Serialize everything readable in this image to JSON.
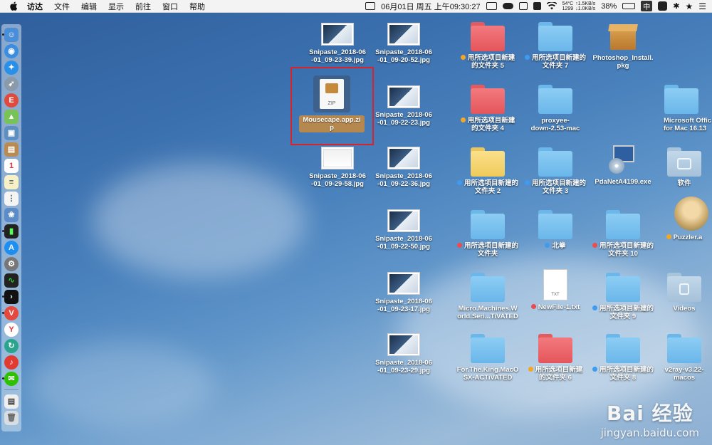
{
  "menubar": {
    "app_name": "访达",
    "menus": [
      "文件",
      "编辑",
      "显示",
      "前往",
      "窗口",
      "帮助"
    ],
    "temp": "54°C",
    "fan": "1299",
    "net_up": "↑1.5KB/s",
    "net_down": "↓1.0KB/s",
    "datetime": "06月01日 周五 上午09:30:27",
    "battery": "38%",
    "input_method": "中"
  },
  "desktop": {
    "items": [
      {
        "label": "Snipaste_2018-06\n-01_09-23-39.jpg",
        "type": "thumb",
        "tag": ""
      },
      {
        "label": "Snipaste_2018-06\n-01_09-20-52.jpg",
        "type": "thumb",
        "tag": ""
      },
      {
        "label": "用所选项目新建\n的文件夹 5",
        "type": "folder-red",
        "tag": "orange"
      },
      {
        "label": "用所选项目新建的\n文件夹 7",
        "type": "folder-blue",
        "tag": "blue"
      },
      {
        "label": "Photoshop_Install.\npkg",
        "type": "pkg",
        "tag": ""
      },
      {
        "label": "Mousecape.app.zi\np",
        "type": "zip",
        "tag": ""
      },
      {
        "label": "Snipaste_2018-06\n-01_09-22-23.jpg",
        "type": "thumb",
        "tag": ""
      },
      {
        "label": "用所选项目新建\n的文件夹 4",
        "type": "folder-red",
        "tag": "orange"
      },
      {
        "label": "proxyee-\ndown-2.53-mac",
        "type": "folder-blue",
        "tag": ""
      },
      {
        "label": "Microsoft Offic\nfor Mac 16.13",
        "type": "folder-blue",
        "tag": ""
      },
      {
        "label": "Snipaste_2018-06\n-01_09-29-58.jpg",
        "type": "thumb-white",
        "tag": ""
      },
      {
        "label": "Snipaste_2018-06\n-01_09-22-36.jpg",
        "type": "thumb",
        "tag": ""
      },
      {
        "label": "用所选项目新建的\n文件夹 2",
        "type": "folder-yellow",
        "tag": "blue"
      },
      {
        "label": "用所选项目新建的\n文件夹 3",
        "type": "folder-blue",
        "tag": "blue"
      },
      {
        "label": "PdaNetA4199.exe",
        "type": "exe",
        "tag": ""
      },
      {
        "label": "软件",
        "type": "folder-gray",
        "tag": ""
      },
      {
        "label": "Snipaste_2018-06\n-01_09-22-50.jpg",
        "type": "thumb",
        "tag": ""
      },
      {
        "label": "用所选项目新建的\n文件夹",
        "type": "folder-blue",
        "tag": "red"
      },
      {
        "label": "北拳",
        "type": "folder-blue",
        "tag": "blue"
      },
      {
        "label": "用所选项目新建的\n文件夹 10",
        "type": "folder-blue",
        "tag": "red"
      },
      {
        "label": "Puzzler.a",
        "type": "avatar",
        "tag": "orange"
      },
      {
        "label": "Snipaste_2018-06\n-01_09-23-17.jpg",
        "type": "thumb",
        "tag": ""
      },
      {
        "label": "Micro.Machines.W\norld.Seri...TiVATED",
        "type": "folder-blue",
        "tag": ""
      },
      {
        "label": "NewFile-1.txt",
        "type": "txt",
        "tag": "red"
      },
      {
        "label": "用所选项目新建的\n文件夹 9",
        "type": "folder-blue",
        "tag": "blue"
      },
      {
        "label": "Videos",
        "type": "folder-gray",
        "tag": ""
      },
      {
        "label": "Snipaste_2018-06\n-01_09-23-29.jpg",
        "type": "thumb",
        "tag": ""
      },
      {
        "label": "For.The.King.MacO\nSX-ACTiVATED",
        "type": "folder-blue",
        "tag": ""
      },
      {
        "label": "用所选项目新建\n的文件夹 6",
        "type": "folder-red",
        "tag": "orange"
      },
      {
        "label": "用所选项目新建的\n文件夹 8",
        "type": "folder-blue",
        "tag": "blue"
      },
      {
        "label": "v2ray-v3.22-\nmacos",
        "type": "folder-blue",
        "tag": ""
      }
    ]
  },
  "watermark": {
    "brand": "Bai 经验",
    "url": "jingyan.baidu.com"
  },
  "colors": {
    "selection_outline": "#d8232a",
    "zip_label_bg": "#b5884f"
  }
}
